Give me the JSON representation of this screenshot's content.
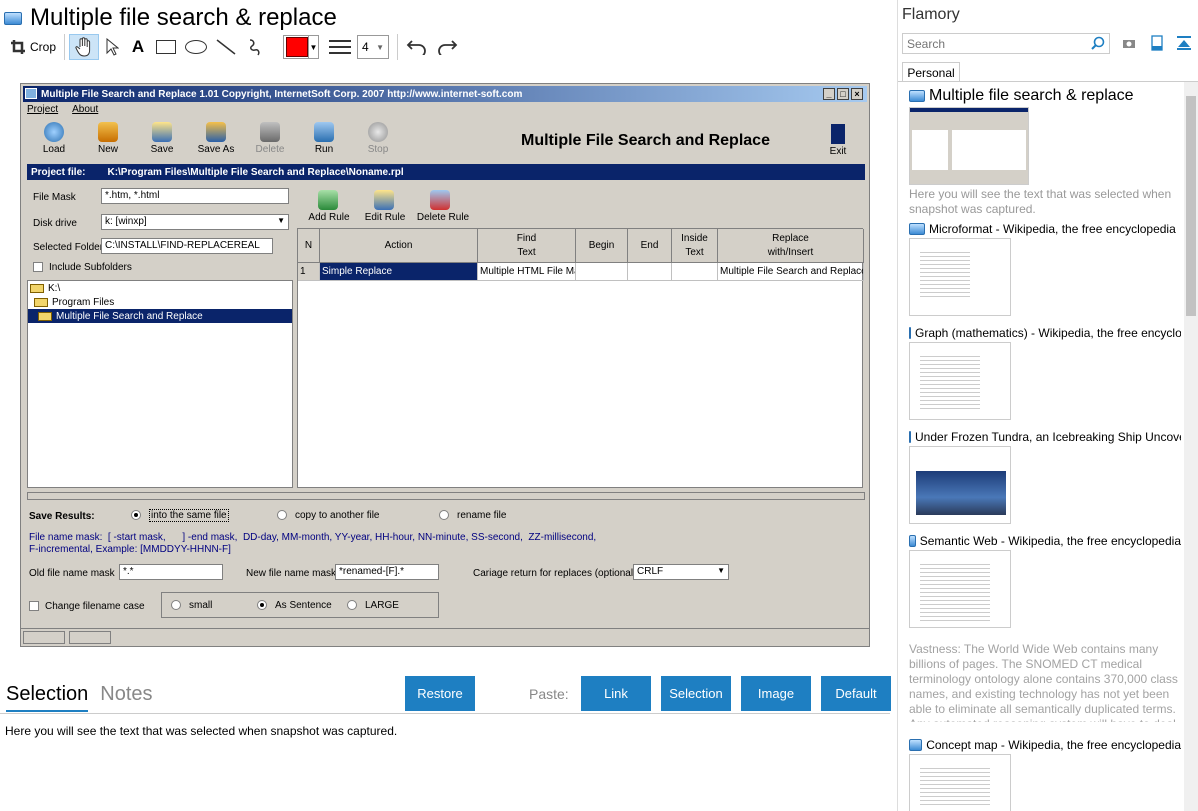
{
  "header": {
    "title": "Multiple file search & replace"
  },
  "toolbar": {
    "crop_label": "Crop",
    "text_tool": "A",
    "line_width": "4"
  },
  "screenshot": {
    "window_title": "Multiple File Search and Replace 1.01   Copyright, InternetSoft Corp. 2007    http://www.internet-soft.com",
    "menu": [
      "Project",
      "About"
    ],
    "tools": [
      "Load",
      "New",
      "Save",
      "Save As",
      "Delete",
      "Run",
      "Stop"
    ],
    "big_title": "Multiple File Search and Replace",
    "exit_label": "Exit",
    "project_label": "Project file:",
    "project_path": "K:\\Program Files\\Multiple File Search and Replace\\Noname.rpl",
    "file_mask_label": "File Mask",
    "file_mask_value": "*.htm, *.html",
    "disk_drive_label": "Disk drive",
    "disk_drive_value": "k: [winxp]",
    "selected_folder_label": "Selected Folder",
    "selected_folder_value": "C:\\INSTALL\\FIND-REPLACEREAL",
    "include_subfolders": "Include Subfolders",
    "tree": [
      "K:\\",
      "Program Files",
      "Multiple File Search and Replace"
    ],
    "rule_tools": [
      "Add Rule",
      "Edit Rule",
      "Delete Rule"
    ],
    "columns": [
      "N",
      "Action",
      "Find\nText",
      "Begin",
      "End",
      "Inside\nText",
      "Replace\nwith/Insert"
    ],
    "row": {
      "n": "1",
      "action": "Simple Replace",
      "find": "Multiple HTML File Mak",
      "replace": "Multiple File Search and Replace"
    },
    "save_results_label": "Save Results:",
    "save_opts": [
      "into the same file",
      "copy to another file",
      "rename file"
    ],
    "mask_help1": "File name mask:  [ -start mask,      ] -end mask,  DD-day, MM-month, YY-year, HH-hour, NN-minute, SS-second,  ZZ-millisecond,",
    "mask_help2": "F-incremental, Example:  [MMDDYY-HHNN-F]",
    "old_mask_label": "Old file name mask",
    "old_mask_value": "*.*",
    "new_mask_label": "New file name mask",
    "new_mask_value": "*renamed-[F].*",
    "cr_label": "Cariage return for replaces (optionally)",
    "cr_value": "CRLF",
    "change_case": "Change filename case",
    "case_opts": [
      "small",
      "As Sentence",
      "LARGE"
    ]
  },
  "bottom": {
    "tabs": [
      "Selection",
      "Notes"
    ],
    "restore": "Restore",
    "paste_label": "Paste:",
    "paste_buttons": [
      "Link",
      "Selection",
      "Image",
      "Default"
    ],
    "selection_text": "Here you will see the text that was selected when snapshot was captured."
  },
  "side": {
    "app_name": "Flamory",
    "search_placeholder": "Search",
    "tab": "Personal",
    "items": [
      {
        "title": "Multiple file search & replace",
        "desc": "Here you will see the text that was selected when snapshot was captured."
      },
      {
        "title": "Microformat - Wikipedia, the free encyclopedia",
        "desc": ""
      },
      {
        "title": "Graph (mathematics) - Wikipedia, the free encyclopedia",
        "desc": ""
      },
      {
        "title": "Under Frozen Tundra, an Icebreaking Ship Uncovers",
        "desc": ""
      },
      {
        "title": "Semantic Web - Wikipedia, the free encyclopedia",
        "desc": "Vastness: The World Wide Web contains many billions of pages. The SNOMED CT medical terminology ontology alone contains 370,000 class names, and existing technology has not yet been able to eliminate all semantically duplicated terms. Any automated reasoning system will have to deal with truly huge inputs."
      },
      {
        "title": "Concept map - Wikipedia, the free encyclopedia",
        "desc": ""
      }
    ]
  }
}
